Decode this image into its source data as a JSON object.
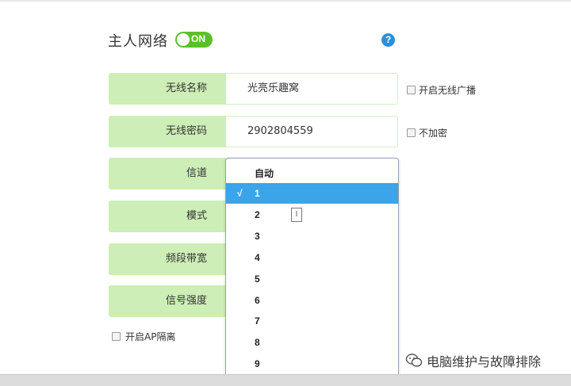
{
  "header": {
    "title": "主人网络",
    "toggle_label": "ON",
    "help": "?"
  },
  "fields": [
    {
      "label": "无线名称",
      "value": "光亮乐趣窝"
    },
    {
      "label": "无线密码",
      "value": "2902804559"
    },
    {
      "label": "信道",
      "value": ""
    },
    {
      "label": "模式",
      "value": ""
    },
    {
      "label": "频段带宽",
      "value": ""
    },
    {
      "label": "信号强度",
      "value": ""
    }
  ],
  "side_options": {
    "broadcast": "开启无线广播",
    "no_encrypt": "不加密"
  },
  "ap_isolation": "开启AP隔离",
  "channel_dropdown": {
    "options": [
      "自动",
      "1",
      "2",
      "3",
      "4",
      "5",
      "6",
      "7",
      "8",
      "9"
    ],
    "selected": "1",
    "check_mark": "√"
  },
  "cursor_glyph": "I",
  "watermark": "电脑维护与故障排除",
  "colors": {
    "label_bg": "#cdeeb6",
    "toggle_on": "#5cbf2a",
    "selected_option": "#3aa5e8",
    "help_icon": "#2d8fd5"
  }
}
